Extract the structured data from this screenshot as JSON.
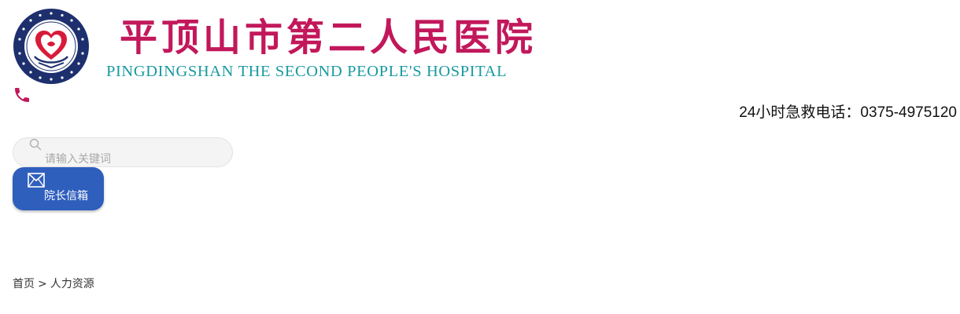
{
  "header": {
    "title_cn": "平顶山市第二人民医院",
    "title_en": "PINGDINGSHAN THE SECOND PEOPLE'S HOSPITAL",
    "emblem_text": "平顶山市第二人民医院 PINGDINGSHAN THE SECOND PEOPLE'S HOSPITAL",
    "emblem_icon": "heart-emblem-icon",
    "hotline": "24小时急救电话：0375-4975120",
    "phone_icon": "phone-icon"
  },
  "search": {
    "placeholder": "请输入关键词",
    "value": "",
    "icon": "search-icon"
  },
  "mailbox": {
    "label": "院长信箱",
    "icon": "envelope-icon"
  },
  "breadcrumb": {
    "items": [
      "首页",
      "人力资源"
    ],
    "separator": ">"
  },
  "colors": {
    "brand_magenta": "#c2185b",
    "brand_teal": "#199aa0",
    "emblem_navy": "#1e2f6e",
    "button_blue": "#2f5fbd",
    "search_bg": "#f4f4f4"
  }
}
